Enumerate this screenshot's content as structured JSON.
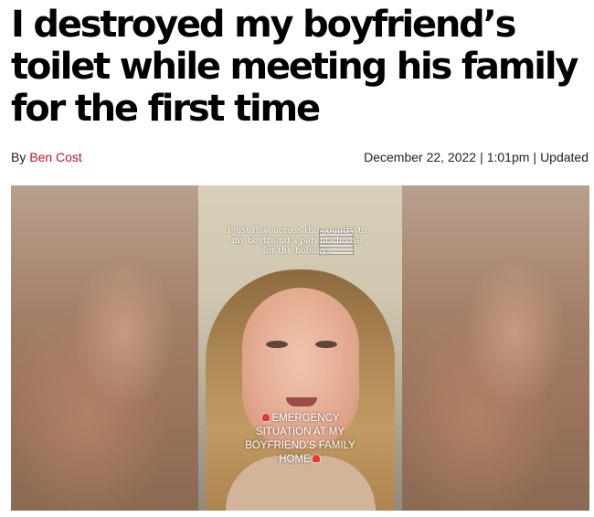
{
  "article": {
    "headline_lines": [
      "I destroyed my boyfriend’s",
      "toilet while meeting his family",
      "for the first time"
    ],
    "byline_prefix": "By",
    "author": "Ben Cost",
    "date": "December 22, 2022",
    "time": "1:01pm",
    "updated_label": "Updated",
    "separator": "|"
  },
  "media": {
    "caption_top": "I just flew across the country to my boyfriend’s parents house for the holidays",
    "caption_bottom_lines": [
      "EMERGENCY",
      "SITUATION AT MY",
      "BOYFRIEND’S FAMILY",
      "HOME"
    ],
    "icons": [
      "siren-icon",
      "siren-icon"
    ]
  }
}
